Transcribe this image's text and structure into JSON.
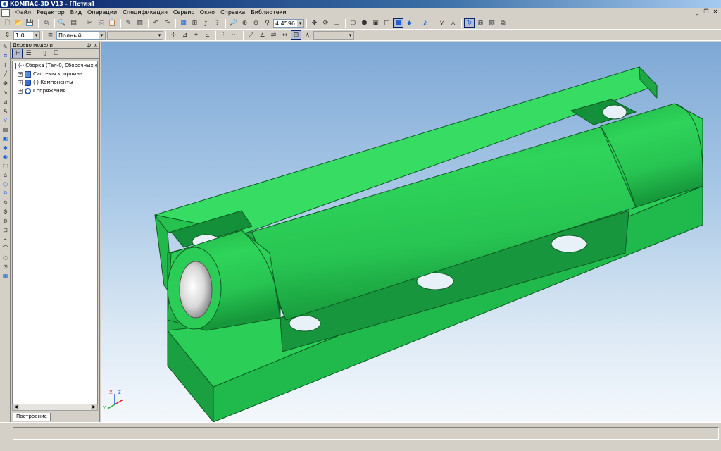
{
  "window": {
    "title": "КОМПАС-3D V13 - [Петля]"
  },
  "menu": [
    "Файл",
    "Редактор",
    "Вид",
    "Операции",
    "Спецификация",
    "Сервис",
    "Окно",
    "Справка",
    "Библиотеки"
  ],
  "toolbar": {
    "zoom_value": "4.4596",
    "scale_value": "1.0",
    "line_style": "Полный"
  },
  "tree": {
    "title": "Дерево модели",
    "pin_glyph": "ф",
    "close_glyph": "x",
    "root": "(-) Сборка (Тел-0, Сборочных е",
    "items": [
      "Системы координат",
      "(-) Компоненты",
      "Сопряжения"
    ],
    "tab": "Построение"
  },
  "axes": {
    "z": "Z",
    "x": "X",
    "y": "Y"
  },
  "colors": {
    "model_green": "#2ed158",
    "model_dark": "#1a8f3a",
    "accent": "#0a246a"
  }
}
